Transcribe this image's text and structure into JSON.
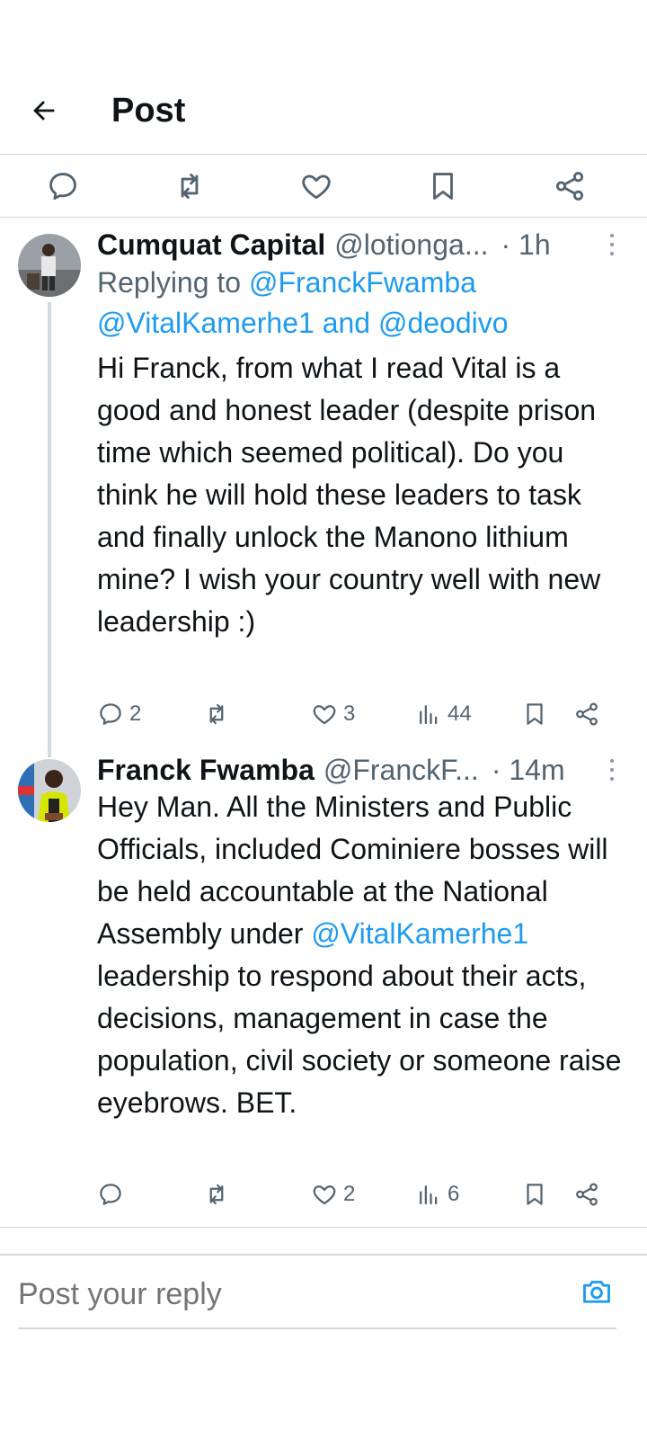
{
  "header": {
    "title": "Post"
  },
  "colors": {
    "accent": "#1d9bf0",
    "muted": "#536471",
    "text": "#0f1419",
    "border": "#cfd9de"
  },
  "tweets": [
    {
      "name": "Cumquat Capital",
      "handle": "@lotionga...",
      "time": "· 1h",
      "reply_prefix": "Replying to ",
      "reply_mention_1": "@FranckFwamba",
      "reply_mention_2": "@VitalKamerhe1",
      "reply_and": " and ",
      "reply_mention_3": "@deodivo",
      "text": "Hi Franck, from what I read Vital is a good and honest leader (despite prison time which seemed political). Do you think he will hold these leaders to task and finally unlock the Manono lithium mine? I wish your country well with new leadership :)",
      "replies": "2",
      "likes": "3",
      "views": "44"
    },
    {
      "name": "Franck Fwamba",
      "handle": "@FranckF...",
      "time": "· 14m",
      "text_before": "Hey Man. All the Ministers and Public Officials, included Cominiere bosses will be held accountable at the National Assembly under ",
      "text_mention": "@VitalKamerhe1",
      "text_after": " leadership to respond about their acts, decisions, management in case the population, civil society or someone raise eyebrows. BET.",
      "likes": "2",
      "views": "6"
    }
  ],
  "reply_box": {
    "placeholder": "Post your reply"
  }
}
